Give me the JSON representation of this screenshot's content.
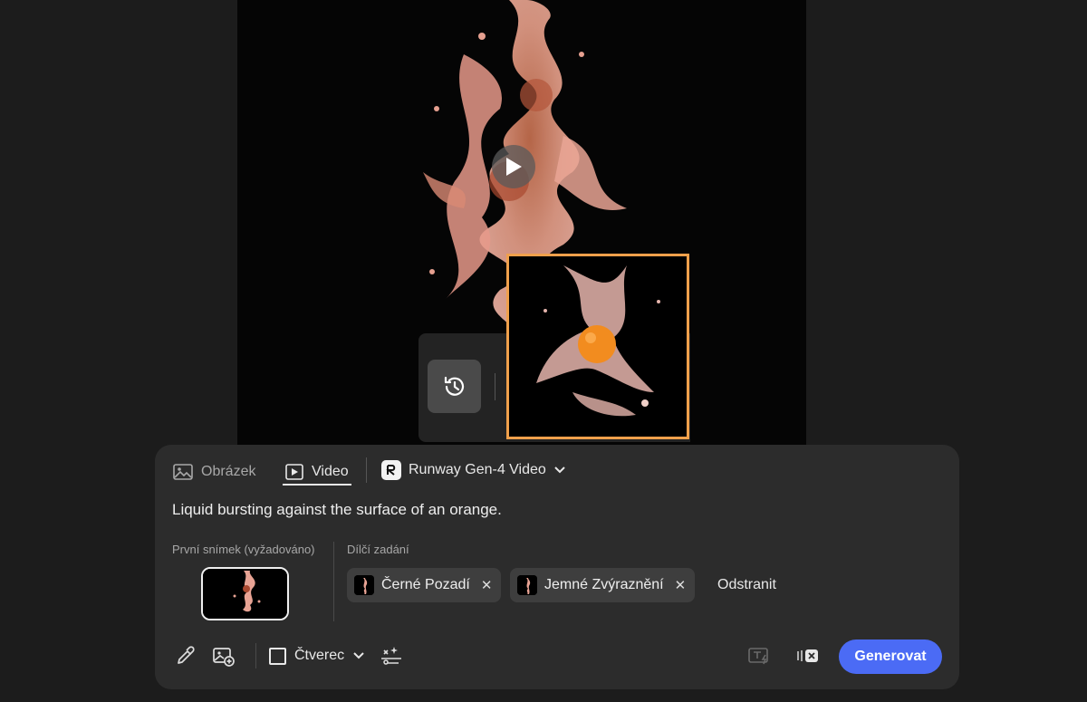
{
  "colors": {
    "accent": "#4b6bf5",
    "selection": "#f0a04b",
    "panel": "#2c2c2c",
    "background": "#1c1c1c"
  },
  "preview": {
    "play_icon": "play-icon",
    "history_icon": "history-icon"
  },
  "tabs": [
    {
      "label": "Obrázek",
      "icon": "image-icon",
      "active": false
    },
    {
      "label": "Video",
      "icon": "video-icon",
      "active": true
    }
  ],
  "model": {
    "label": "Runway Gen-4 Video",
    "icon": "runway-logo-icon"
  },
  "prompt": "Liquid bursting against the surface of an orange.",
  "first_frame": {
    "label": "První snímek (vyžadováno)"
  },
  "sub_prompts": {
    "label": "Dílčí zadání",
    "chips": [
      {
        "label": "Černé Pozadí"
      },
      {
        "label": "Jemné Zvýraznění"
      }
    ],
    "remove_label": "Odstranit"
  },
  "toolbar": {
    "aspect_label": "Čtverec",
    "generate_label": "Generovat"
  }
}
